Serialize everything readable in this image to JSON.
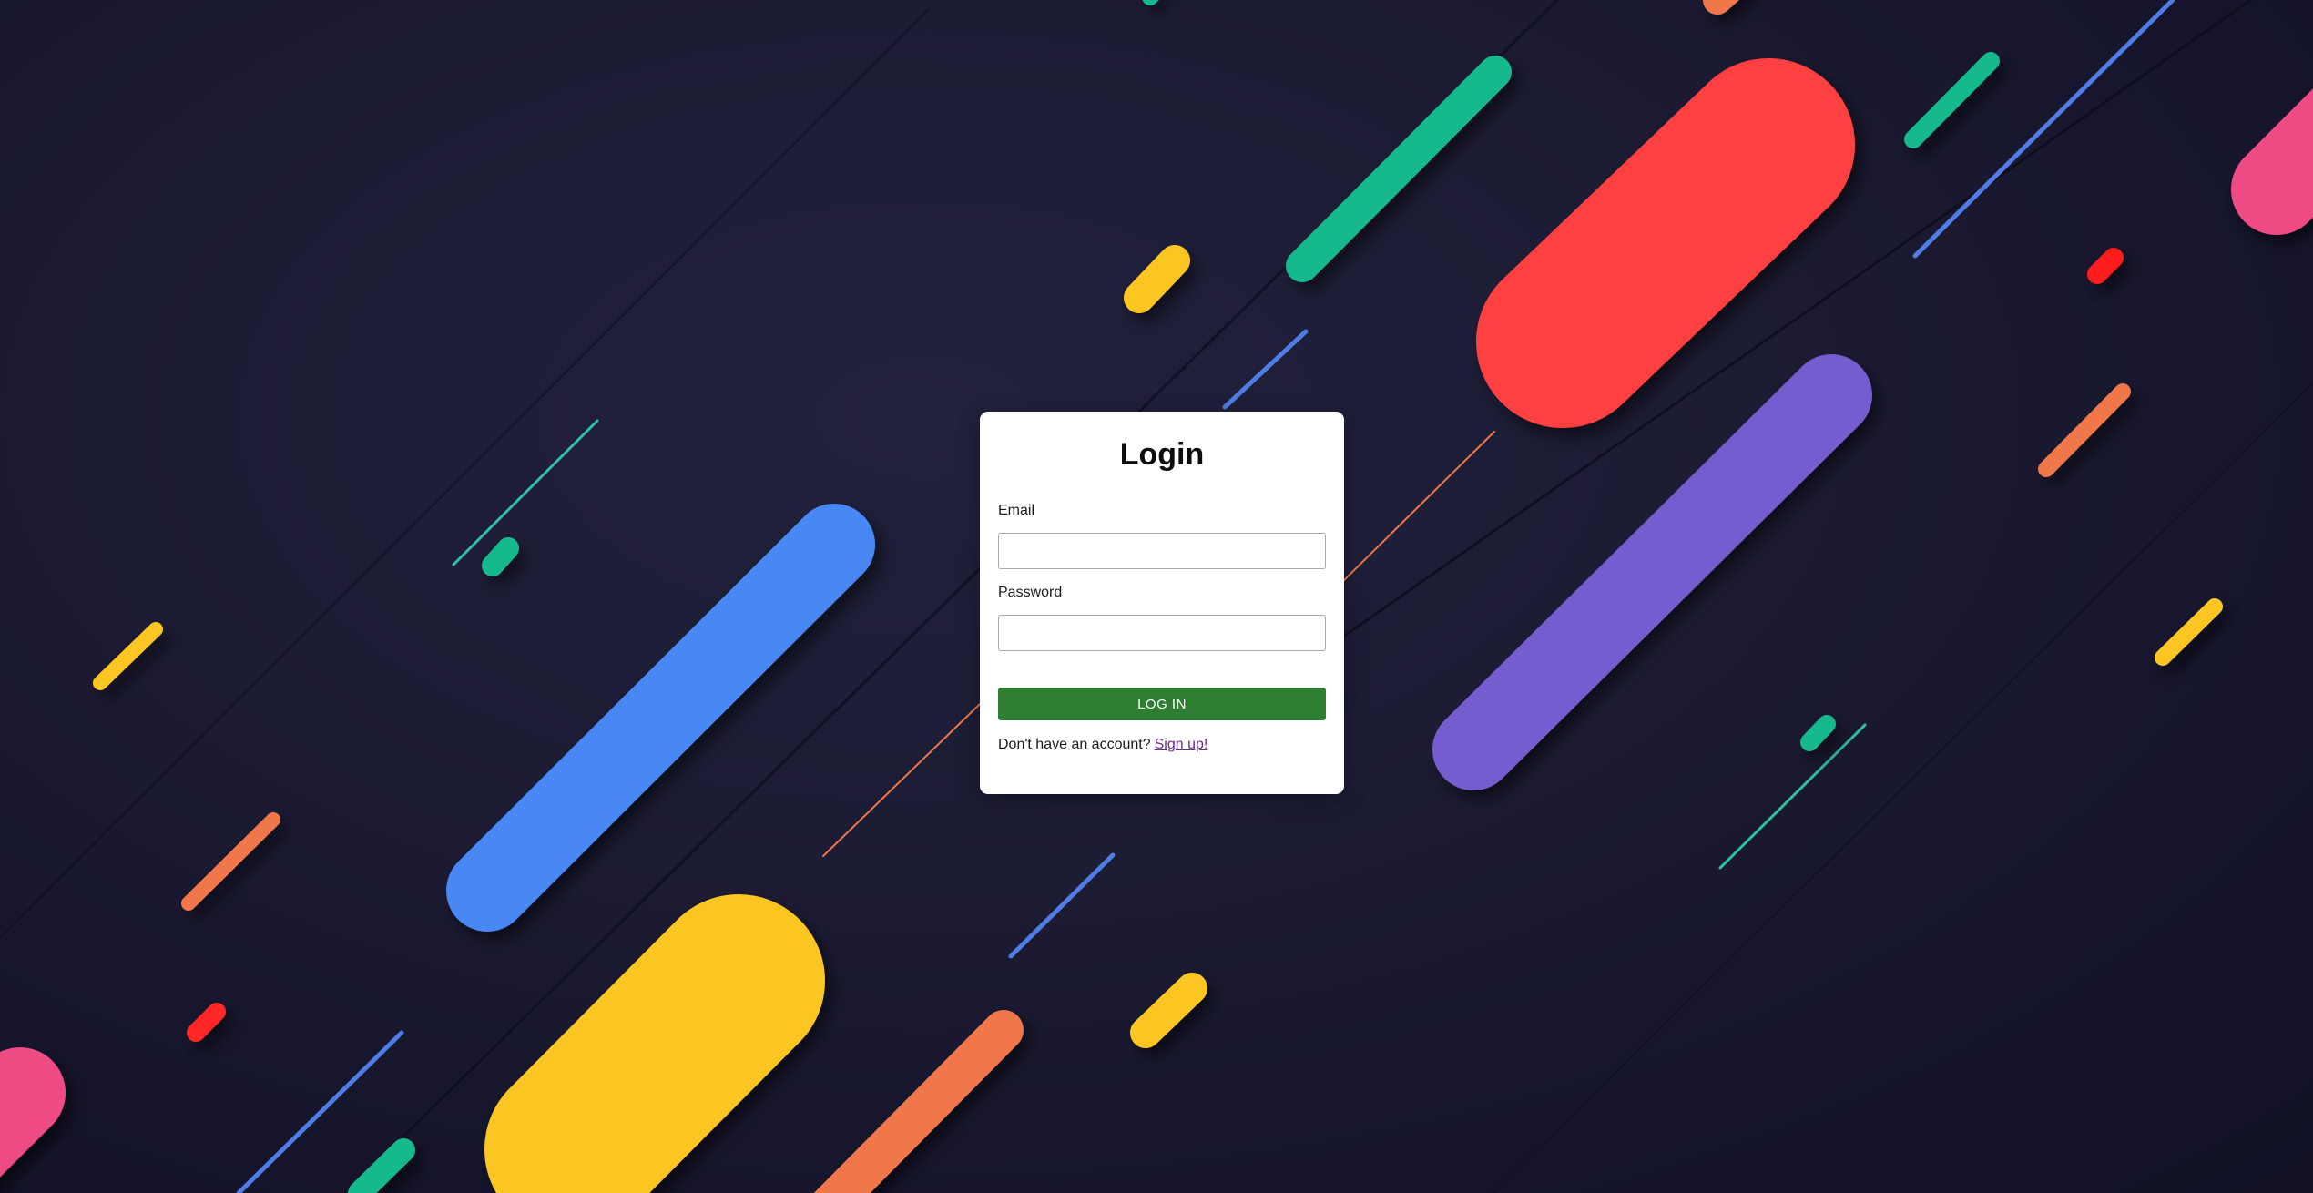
{
  "login": {
    "title": "Login",
    "email_label": "Email",
    "email_value": "",
    "password_label": "Password",
    "password_value": "",
    "submit_label": "LOG IN",
    "signup_prompt": "Don't have an account?",
    "signup_link": "Sign up!"
  },
  "colors": {
    "card_background": "#ffffff",
    "button": "#2e7d32",
    "link": "#6b2c91",
    "page_background": "#1c1b33",
    "decor_palette": [
      "#4688f4",
      "#fbc523",
      "#ff4040",
      "#745ccf",
      "#12b98b",
      "#ef774a",
      "#ee4b84"
    ]
  }
}
